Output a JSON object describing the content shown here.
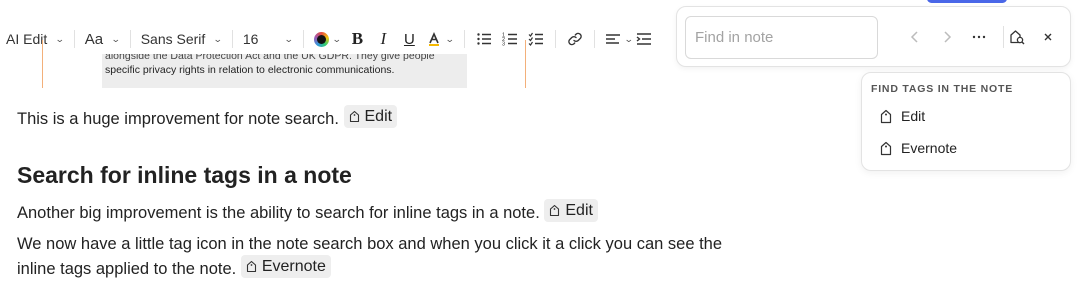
{
  "toolbar": {
    "ai_edit_label": "AI Edit",
    "text_style_label": "Aa",
    "font_family_label": "Sans Serif",
    "font_size_label": "16",
    "bold_label": "B",
    "italic_label": "I",
    "underline_label": "U"
  },
  "doc_image": {
    "line1": "alongside the Data Protection Act and the UK GDPR. They give people",
    "line2": "specific privacy rights in relation to electronic communications."
  },
  "content": {
    "para1": "This is a huge improvement for note search.",
    "para1_tag": "Edit",
    "heading": "Search for inline tags in a note",
    "para2": "Another big improvement is the ability to search for inline tags in a note.",
    "para2_tag": "Edit",
    "para3_line1": "We now have a little tag icon in the note search box and when you click it a click you can see the",
    "para3_line2": "inline tags applied to the note.",
    "para3_tag": "Evernote"
  },
  "find": {
    "placeholder": "Find in note",
    "value": ""
  },
  "tag_dropdown": {
    "heading": "FIND TAGS IN THE NOTE",
    "items": [
      {
        "label": "Edit"
      },
      {
        "label": "Evernote"
      }
    ]
  },
  "colors": {
    "accent_blue": "#4a67e8",
    "chip_background": "#eeeeee",
    "image_border": "#f3b07a"
  }
}
